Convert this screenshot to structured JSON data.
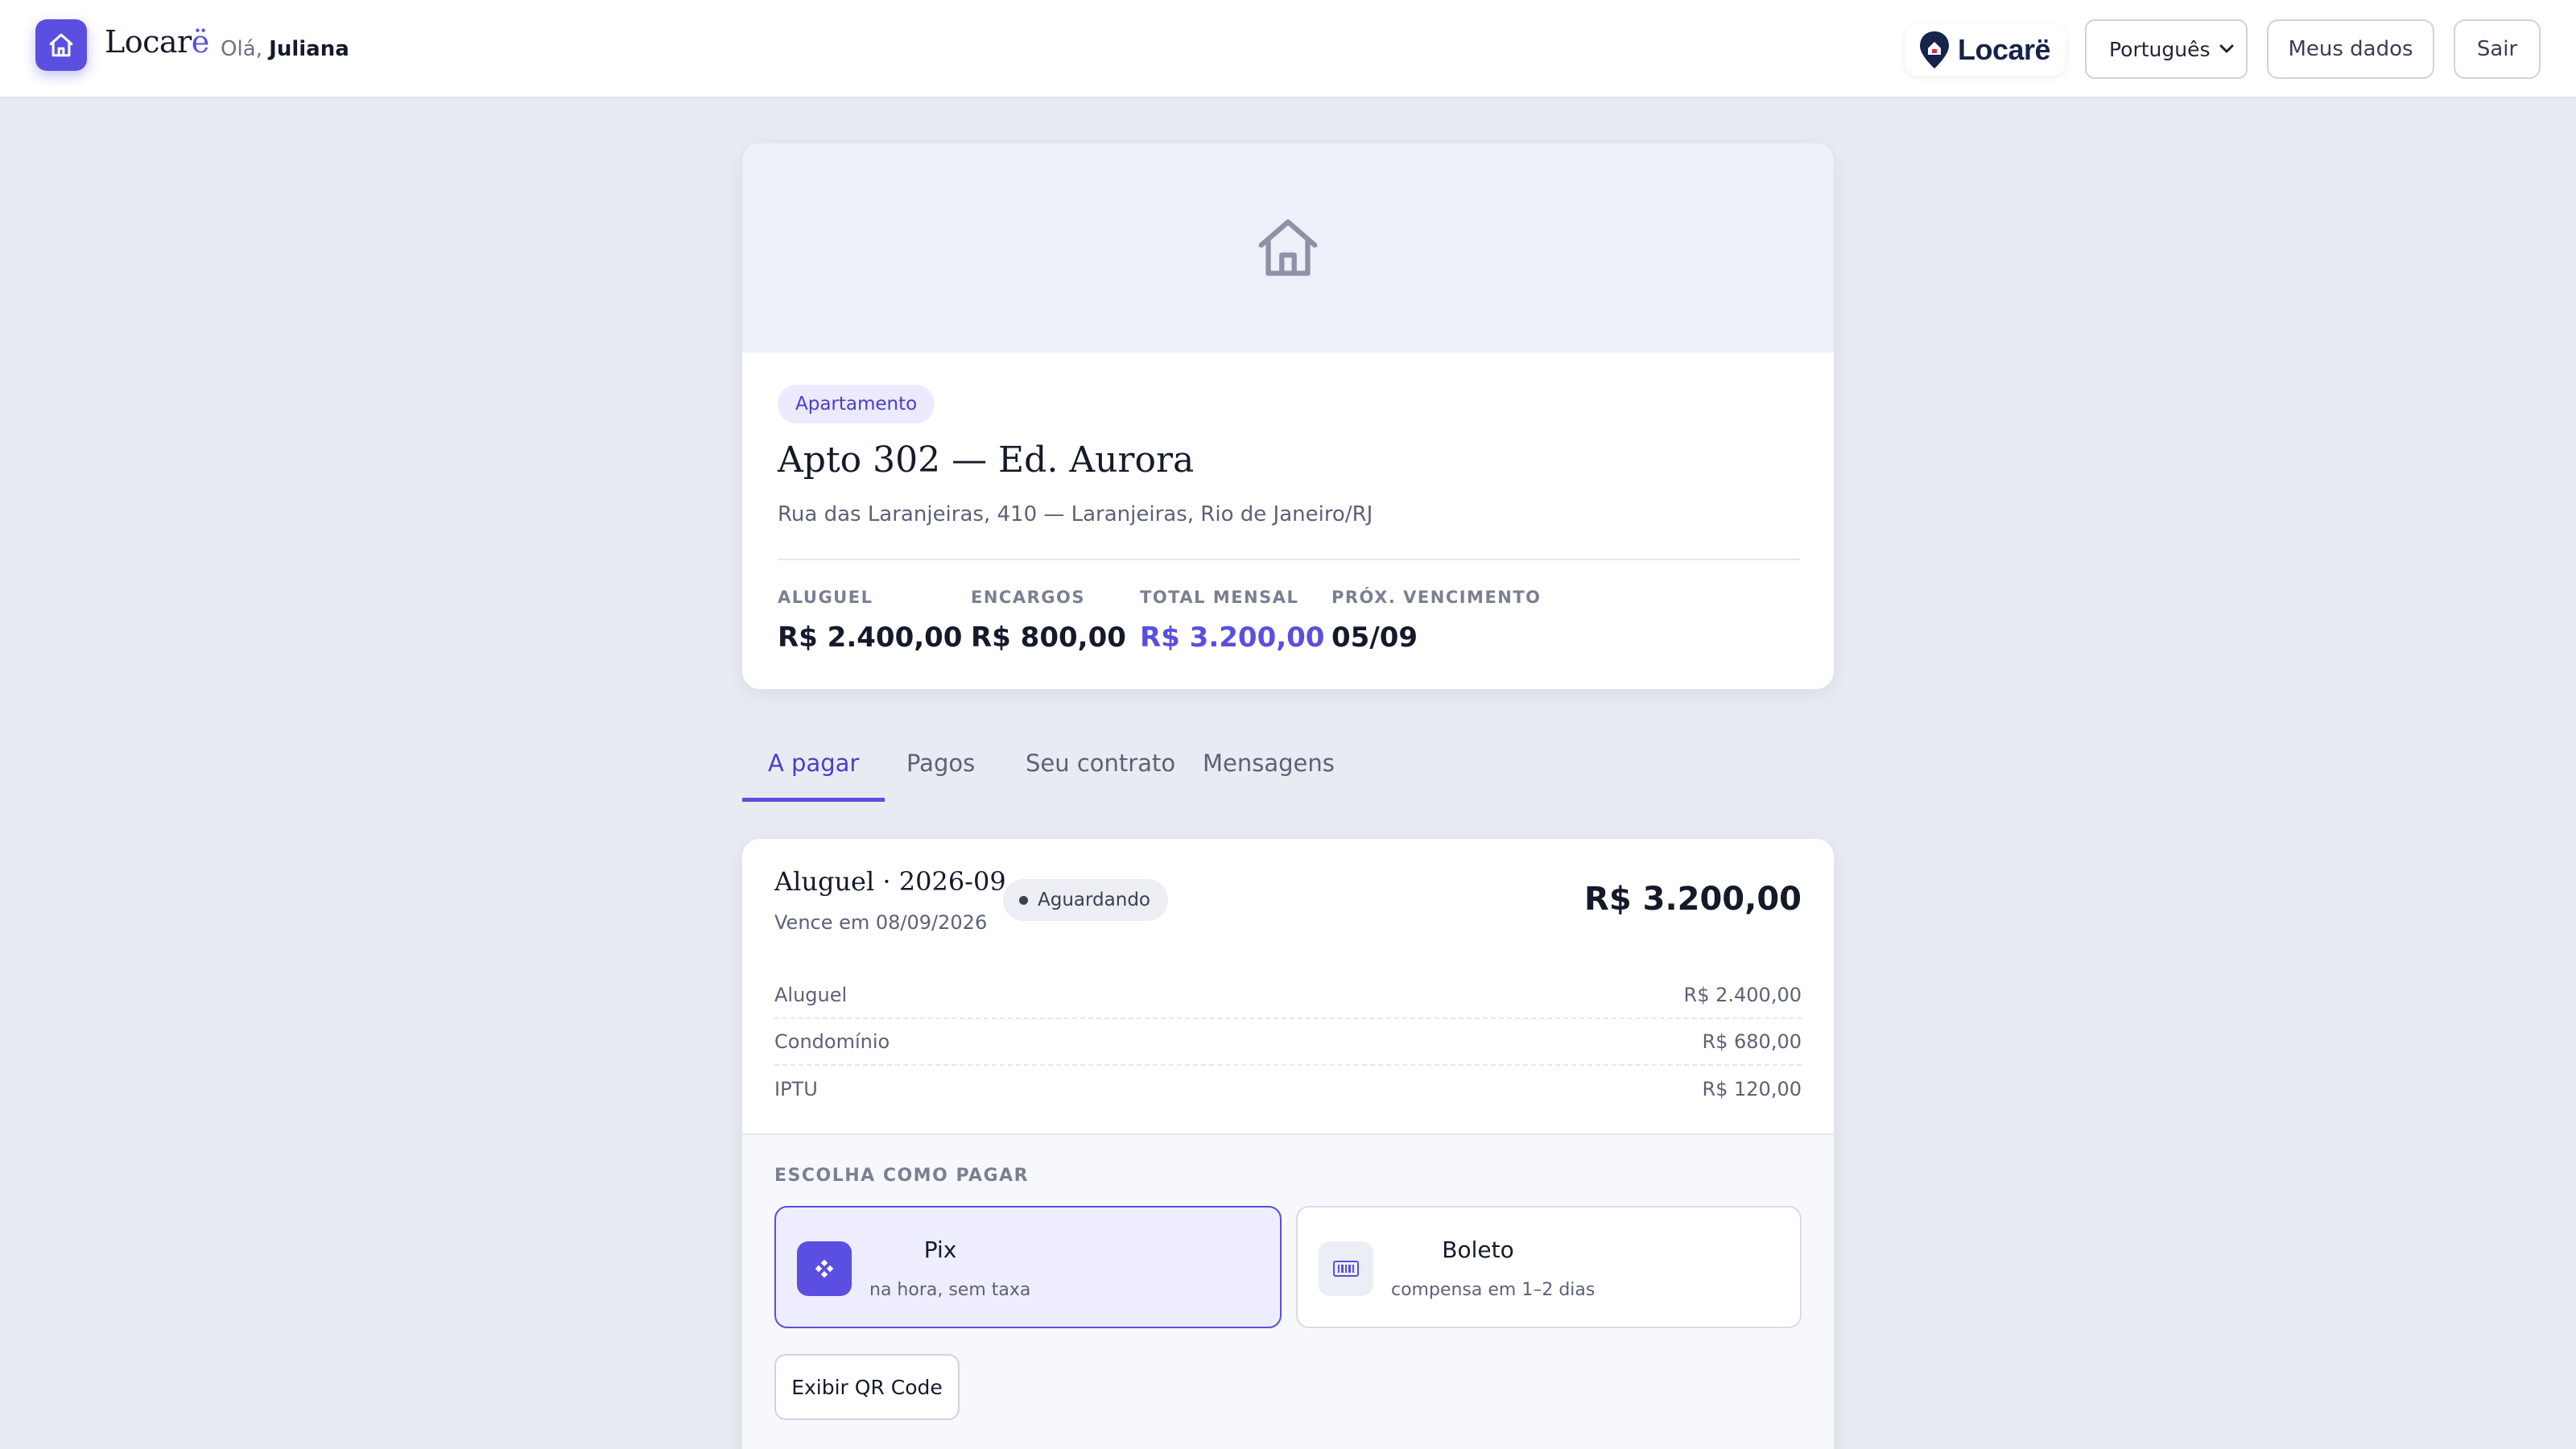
{
  "header": {
    "brand": "Locar",
    "brand_umlaut": "ë",
    "greeting_prefix": "Olá,",
    "user_name": "Juliana",
    "logo_text": "Locarë",
    "language": "Português",
    "my_data_label": "Meus dados",
    "logout_label": "Sair"
  },
  "property": {
    "type": "Apartamento",
    "name": "Apto 302 — Ed. Aurora",
    "address": "Rua das Laranjeiras, 410 — Laranjeiras, Rio de Janeiro/RJ",
    "stats": [
      {
        "label": "ALUGUEL",
        "value": "R$ 2.400,00"
      },
      {
        "label": "ENCARGOS",
        "value": "R$ 800,00"
      },
      {
        "label": "TOTAL MENSAL",
        "value": "R$ 3.200,00"
      },
      {
        "label": "PRÓX. VENCIMENTO",
        "value": "05/09"
      }
    ]
  },
  "tabs": [
    {
      "label": "A pagar",
      "active": true
    },
    {
      "label": "Pagos",
      "active": false
    },
    {
      "label": "Seu contrato",
      "active": false
    },
    {
      "label": "Mensagens",
      "active": false
    }
  ],
  "invoice": {
    "title": "Aluguel · 2026-09",
    "due": "Vence em 08/09/2026",
    "status": "Aguardando",
    "total": "R$ 3.200,00",
    "items": [
      {
        "label": "Aluguel",
        "value": "R$ 2.400,00"
      },
      {
        "label": "Condomínio",
        "value": "R$ 680,00"
      },
      {
        "label": "IPTU",
        "value": "R$ 120,00"
      }
    ],
    "payment": {
      "heading": "ESCOLHA COMO PAGAR",
      "options": [
        {
          "name": "Pix",
          "subtitle": "na hora, sem taxa",
          "selected": true,
          "icon": "pix-icon"
        },
        {
          "name": "Boleto",
          "subtitle": "compensa em 1–2 dias",
          "selected": false,
          "icon": "barcode-icon"
        }
      ],
      "qr_button": "Exibir QR Code"
    }
  },
  "colors": {
    "accent": "#5a4fe0",
    "background": "#e9ebf2"
  }
}
